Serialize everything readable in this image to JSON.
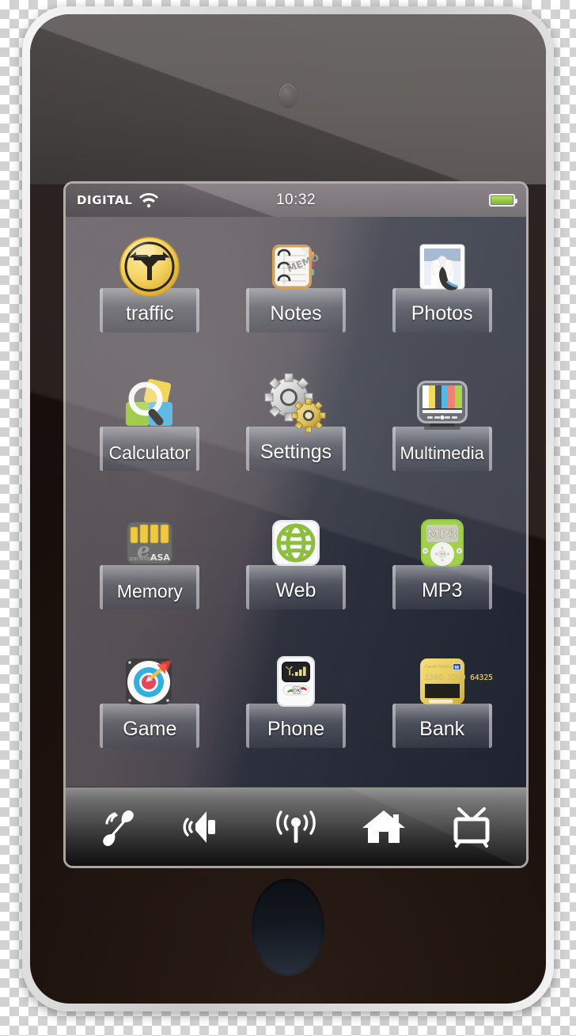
{
  "device": {
    "name": "touchscreen-smartphone",
    "body_color": "#1b100c",
    "frame_color": "#d9d9d9"
  },
  "status_bar": {
    "carrier": "DIGITAL",
    "wifi_icon": "wifi-icon",
    "time": "10:32",
    "battery_icon": "battery-icon",
    "battery_color": "#8ec832",
    "battery_level": "100"
  },
  "home_screen": {
    "apps": [
      {
        "label": "traffic",
        "icon": "traffic-fork-arrow-icon",
        "name": "app-traffic"
      },
      {
        "label": "Notes",
        "icon": "memo-notepad-icon",
        "name": "app-notes",
        "memo_text": "MEMO"
      },
      {
        "label": "Photos",
        "icon": "shirt-tie-photo-icon",
        "name": "app-photos"
      },
      {
        "label": "Calculator",
        "icon": "magnifier-squares-icon",
        "name": "app-calculator"
      },
      {
        "label": "Settings",
        "icon": "gears-icon",
        "name": "app-settings"
      },
      {
        "label": "Multimedia",
        "icon": "tv-color-bars-icon",
        "name": "app-multimedia"
      },
      {
        "label": "Memory",
        "icon": "memory-card-icon",
        "name": "app-memory",
        "card_brand": "ASA",
        "card_code": "25803x0300"
      },
      {
        "label": "Web",
        "icon": "green-globe-icon",
        "name": "app-web"
      },
      {
        "label": "MP3",
        "icon": "mp3-player-icon",
        "name": "app-mp3",
        "screen_text": "MP3"
      },
      {
        "label": "Game",
        "icon": "dartboard-target-icon",
        "name": "app-game"
      },
      {
        "label": "Phone",
        "icon": "feature-phone-icon",
        "name": "app-phone",
        "ok_label": "OK"
      },
      {
        "label": "Bank",
        "icon": "credit-card-icon",
        "name": "app-bank",
        "card_number": "1546 2309 64325"
      }
    ]
  },
  "dock": {
    "items": [
      {
        "icon": "phone-call-icon",
        "name": "dock-call"
      },
      {
        "icon": "speaker-volume-icon",
        "name": "dock-volume"
      },
      {
        "icon": "antenna-signal-icon",
        "name": "dock-signal"
      },
      {
        "icon": "home-icon",
        "name": "dock-home"
      },
      {
        "icon": "television-icon",
        "name": "dock-tv"
      }
    ]
  }
}
